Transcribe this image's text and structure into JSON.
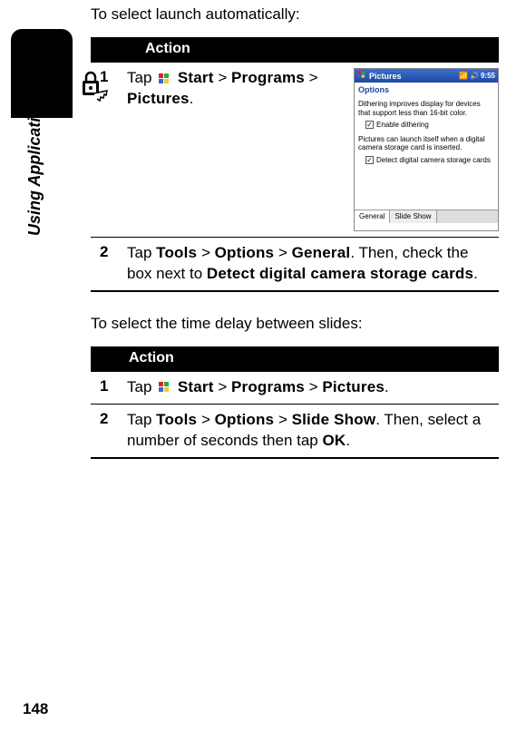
{
  "pageNumber": "148",
  "sideLabel": "Using Applications",
  "intro1": "To select launch automatically:",
  "intro2": "To select the time delay between slides:",
  "actionHeader": "Action",
  "section1": {
    "step1": {
      "num": "1",
      "prefix": "Tap ",
      "start": "Start",
      "sep1": " > ",
      "programs": "Programs",
      "sep2": " > ",
      "pictures": "Pictures",
      "end": "."
    },
    "step2": {
      "num": "2",
      "prefix": "Tap ",
      "tools": "Tools",
      "sep1": " > ",
      "options": "Options",
      "sep2": " > ",
      "general": "General",
      "mid": ". Then, check the box next to ",
      "detect": "Detect digital camera storage cards",
      "end": "."
    }
  },
  "section2": {
    "step1": {
      "num": "1",
      "prefix": "Tap ",
      "start": "Start",
      "sep1": " > ",
      "programs": "Programs",
      "sep2": " > ",
      "pictures": "Pictures",
      "end": "."
    },
    "step2": {
      "num": "2",
      "prefix": "Tap ",
      "tools": "Tools",
      "sep1": " > ",
      "options": "Options",
      "sep2": " > ",
      "slideshow": "Slide Show",
      "mid": ". Then, select a number of seconds then tap ",
      "ok": "OK",
      "end": "."
    }
  },
  "screenshot": {
    "title": "Pictures",
    "time": "9:55",
    "optionsLabel": "Options",
    "text1": "Dithering improves display for devices that support less than 16-bit color.",
    "check1": "Enable dithering",
    "text2": "Pictures can launch itself when a digital camera storage card is inserted.",
    "check2": "Detect digital camera storage cards",
    "tab1": "General",
    "tab2": "Slide Show"
  }
}
